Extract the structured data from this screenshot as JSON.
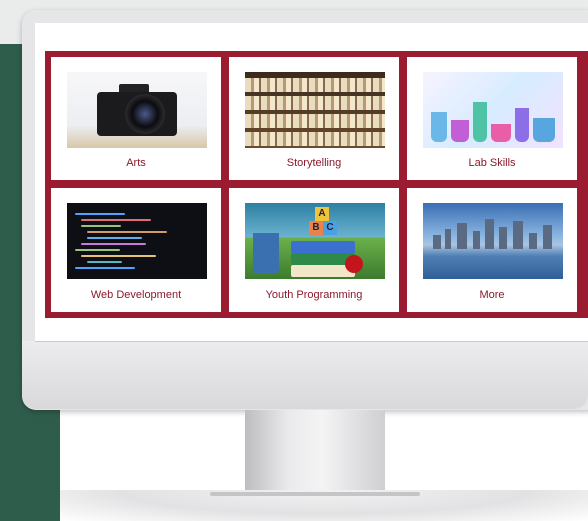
{
  "tiles": [
    {
      "label": "Arts",
      "image": "camera-photo"
    },
    {
      "label": "Storytelling",
      "image": "books-stack-photo"
    },
    {
      "label": "Lab Skills",
      "image": "lab-flasks-photo"
    },
    {
      "label": "Web Development",
      "image": "laptop-code-photo"
    },
    {
      "label": "Youth Programming",
      "image": "school-books-photo"
    },
    {
      "label": "More",
      "image": "city-skyline-photo"
    }
  ],
  "colors": {
    "grid_border": "#9b1b30",
    "label_text": "#8a1a2c",
    "side_panel": "#2f5d4c",
    "monitor_frame": "#e6e6e8"
  }
}
